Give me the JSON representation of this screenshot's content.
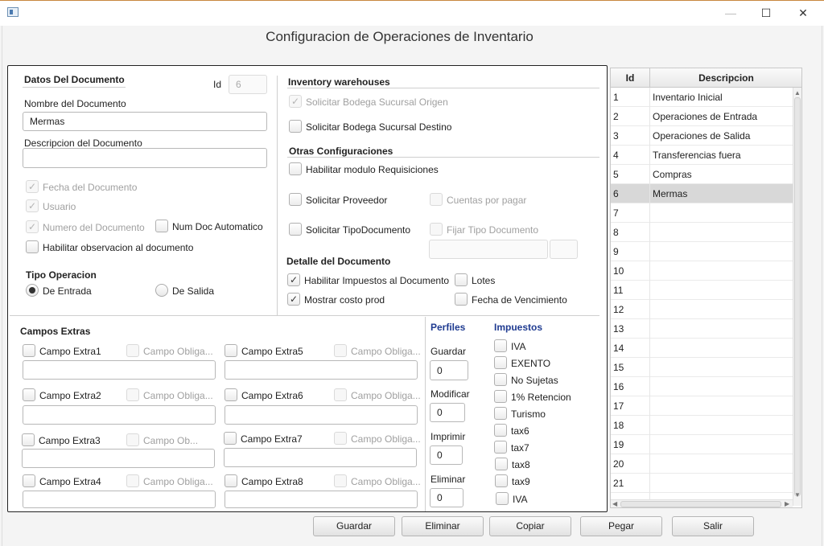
{
  "window": {
    "title": "Configuracion de Operaciones de Inventario"
  },
  "datos": {
    "section": "Datos Del Documento",
    "id_label": "Id",
    "id_value": "6",
    "nombre_label": "Nombre del Documento",
    "nombre_value": "Mermas",
    "descripcion_label": "Descripcion del Documento",
    "descripcion_value": "",
    "fecha": "Fecha del Documento",
    "usuario": "Usuario",
    "numero": "Numero del Documento",
    "num_auto": "Num Doc Automatico",
    "observacion": "Habilitar observacion al documento"
  },
  "tipo": {
    "section": "Tipo Operacion",
    "entrada": "De Entrada",
    "salida": "De Salida",
    "selected": "entrada"
  },
  "warehouses": {
    "section": "Inventory warehouses",
    "origen": "Solicitar Bodega Sucursal Origen",
    "destino": "Solicitar Bodega Sucursal Destino"
  },
  "otras": {
    "section": "Otras Configuraciones",
    "requisiciones": "Habilitar modulo Requisiciones",
    "proveedor": "Solicitar Proveedor",
    "cuentas": "Cuentas por pagar",
    "tipodoc": "Solicitar TipoDocumento",
    "fijar": "Fijar Tipo Documento"
  },
  "detalle": {
    "section": "Detalle del Documento",
    "impuestos": "Habilitar Impuestos al Documento",
    "lotes": "Lotes",
    "costo": "Mostrar costo prod",
    "vencimiento": "Fecha de Vencimiento"
  },
  "campos": {
    "section": "Campos Extras",
    "extra1": "Campo Extra1",
    "extra2": "Campo Extra2",
    "extra3": "Campo Extra3",
    "extra4": "Campo Extra4",
    "extra5": "Campo Extra5",
    "extra6": "Campo Extra6",
    "extra7": "Campo Extra7",
    "extra8": "Campo Extra8",
    "oblig": "Campo Obliga...",
    "oblig_short": "Campo Ob..."
  },
  "perfiles": {
    "section": "Perfiles",
    "guardar": "Guardar",
    "guardar_value": "0",
    "modificar": "Modificar",
    "modificar_value": "0",
    "imprimir": "Imprimir",
    "imprimir_value": "0",
    "eliminar": "Eliminar",
    "eliminar_value": "0"
  },
  "impuestos": {
    "section": "Impuestos",
    "items": [
      "IVA",
      "EXENTO",
      "No Sujetas",
      "1% Retencion",
      "Turismo",
      "tax6",
      "tax7",
      "tax8",
      "tax9",
      "IVA"
    ]
  },
  "table": {
    "col_id": "Id",
    "col_desc": "Descripcion",
    "rows": [
      {
        "id": "1",
        "desc": "Inventario Inicial"
      },
      {
        "id": "2",
        "desc": "Operaciones de Entrada"
      },
      {
        "id": "3",
        "desc": "Operaciones de Salida"
      },
      {
        "id": "4",
        "desc": " Transferencias fuera"
      },
      {
        "id": "5",
        "desc": "Compras"
      },
      {
        "id": "6",
        "desc": "Mermas"
      },
      {
        "id": "7",
        "desc": ""
      },
      {
        "id": "8",
        "desc": ""
      },
      {
        "id": "9",
        "desc": ""
      },
      {
        "id": "10",
        "desc": ""
      },
      {
        "id": "11",
        "desc": ""
      },
      {
        "id": "12",
        "desc": ""
      },
      {
        "id": "13",
        "desc": ""
      },
      {
        "id": "14",
        "desc": ""
      },
      {
        "id": "15",
        "desc": ""
      },
      {
        "id": "16",
        "desc": ""
      },
      {
        "id": "17",
        "desc": ""
      },
      {
        "id": "18",
        "desc": ""
      },
      {
        "id": "19",
        "desc": ""
      },
      {
        "id": "20",
        "desc": ""
      },
      {
        "id": "21",
        "desc": ""
      }
    ],
    "selected_index": 5
  },
  "buttons": {
    "guardar": "Guardar",
    "eliminar": "Eliminar",
    "copiar": "Copiar",
    "pegar": "Pegar",
    "salir": "Salir"
  }
}
